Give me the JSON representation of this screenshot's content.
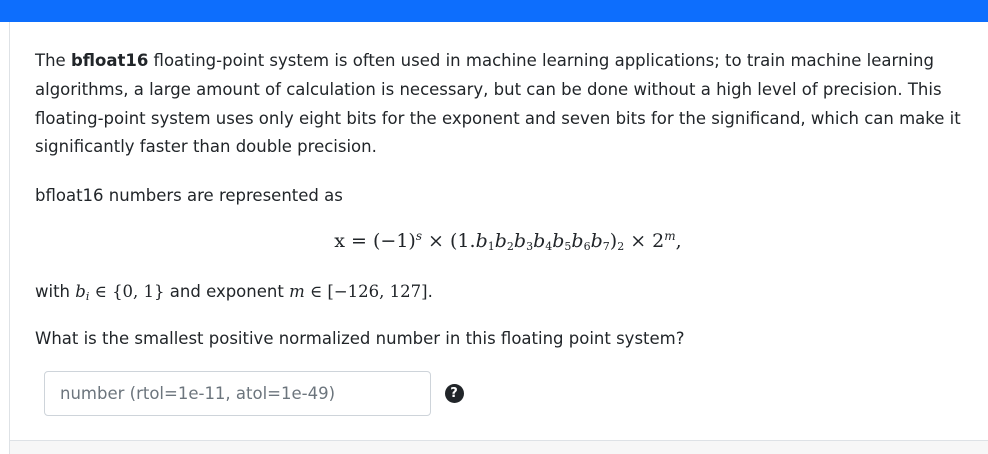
{
  "question": {
    "p1_lead": "The ",
    "p1_bold": "bfloat16",
    "p1_rest": " floating-point system is often used in machine learning applications; to train machine learning algorithms, a large amount of calculation is necessary, but can be done without a high level of precision. This floating-point system uses only eight bits for the exponent and seven bits for the significand, which can make it significantly faster than double precision.",
    "p2": "bfloat16 numbers are represented as",
    "p3_with": "with ",
    "p3_and": " and exponent ",
    "p4": "What is the smallest positive normalized number in this floating point system?"
  },
  "math": {
    "display_lhs": "x = (−1)",
    "display_s": "s",
    "display_times": " × (1.",
    "display_bits": [
      "1",
      "2",
      "3",
      "4",
      "5",
      "6",
      "7"
    ],
    "display_close": ")",
    "display_base_sub": "2",
    "display_pow": " × 2",
    "display_m": "m",
    "display_comma": ",",
    "bi_var": "b",
    "bi_sub": "i",
    "bi_set": " ∈ {0, 1}",
    "m_var": "m",
    "m_range": " ∈ [−126, 127]",
    "period": "."
  },
  "answer": {
    "value": "",
    "placeholder": "number (rtol=1e-11, atol=1e-49)"
  },
  "help": {
    "icon_glyph": "?"
  },
  "colors": {
    "topbar": "#0d6efd",
    "text": "#212529",
    "placeholder": "#6c757d",
    "border": "#ced4da"
  }
}
